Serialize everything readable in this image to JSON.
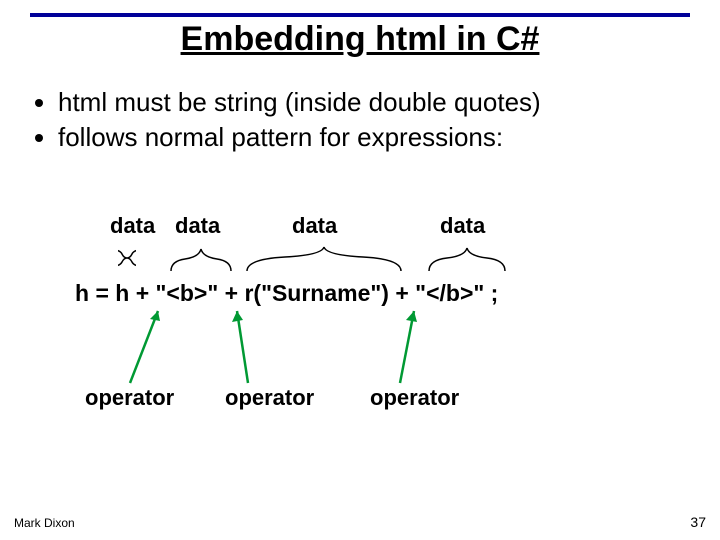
{
  "title": "Embedding html in C#",
  "bullets": [
    "html must be string (inside double quotes)",
    "follows normal pattern for expressions:"
  ],
  "labels": {
    "data1": "data",
    "data2": "data",
    "data3": "data",
    "data4": "data",
    "op1": "operator",
    "op2": "operator",
    "op3": "operator"
  },
  "code": "h = h + \"<b>\" + r(\"Surname\") + \"</b>\" ;",
  "footer": {
    "author": "Mark Dixon",
    "page": "37"
  }
}
